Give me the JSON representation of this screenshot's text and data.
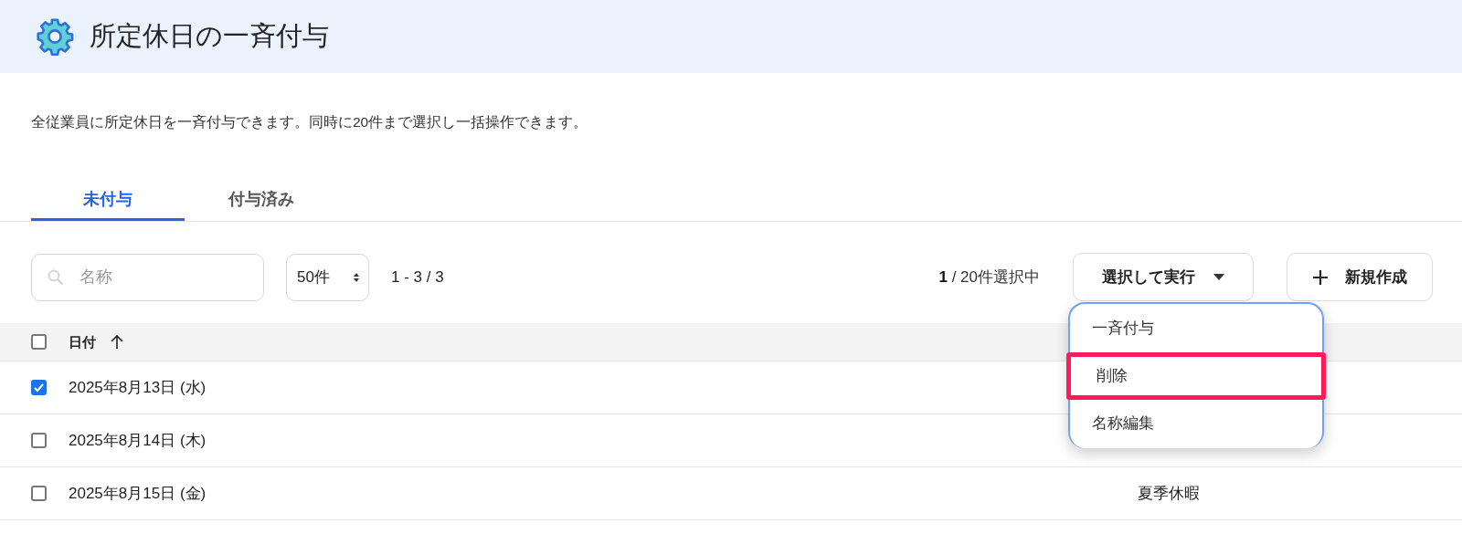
{
  "header": {
    "title": "所定休日の一斉付与"
  },
  "description": "全従業員に所定休日を一斉付与できます。同時に20件まで選択し一括操作できます。",
  "tabs": [
    {
      "label": "未付与",
      "selected": true
    },
    {
      "label": "付与済み",
      "selected": false
    }
  ],
  "toolbar": {
    "search": {
      "placeholder": "名称"
    },
    "page_size": "50件",
    "range": "1 - 3 / 3",
    "selection_count": "1",
    "selection_limit": " / 20件選択中",
    "action_button": "選択して実行",
    "new_button": "新規作成"
  },
  "action_menu": [
    {
      "label": "一斉付与",
      "highlighted": false
    },
    {
      "label": "削除",
      "highlighted": true
    },
    {
      "label": "名称編集",
      "highlighted": false
    }
  ],
  "table": {
    "select_all_checked": false,
    "columns": [
      {
        "label": "日付",
        "sorted_ascending": true
      }
    ],
    "rows": [
      {
        "date": "2025年8月13日 (水)",
        "checked": true
      },
      {
        "date": "2025年8月14日 (木)",
        "checked": false
      },
      {
        "date": "2025年8月15日 (金)",
        "checked": false,
        "name": "夏季休暇"
      }
    ]
  }
}
